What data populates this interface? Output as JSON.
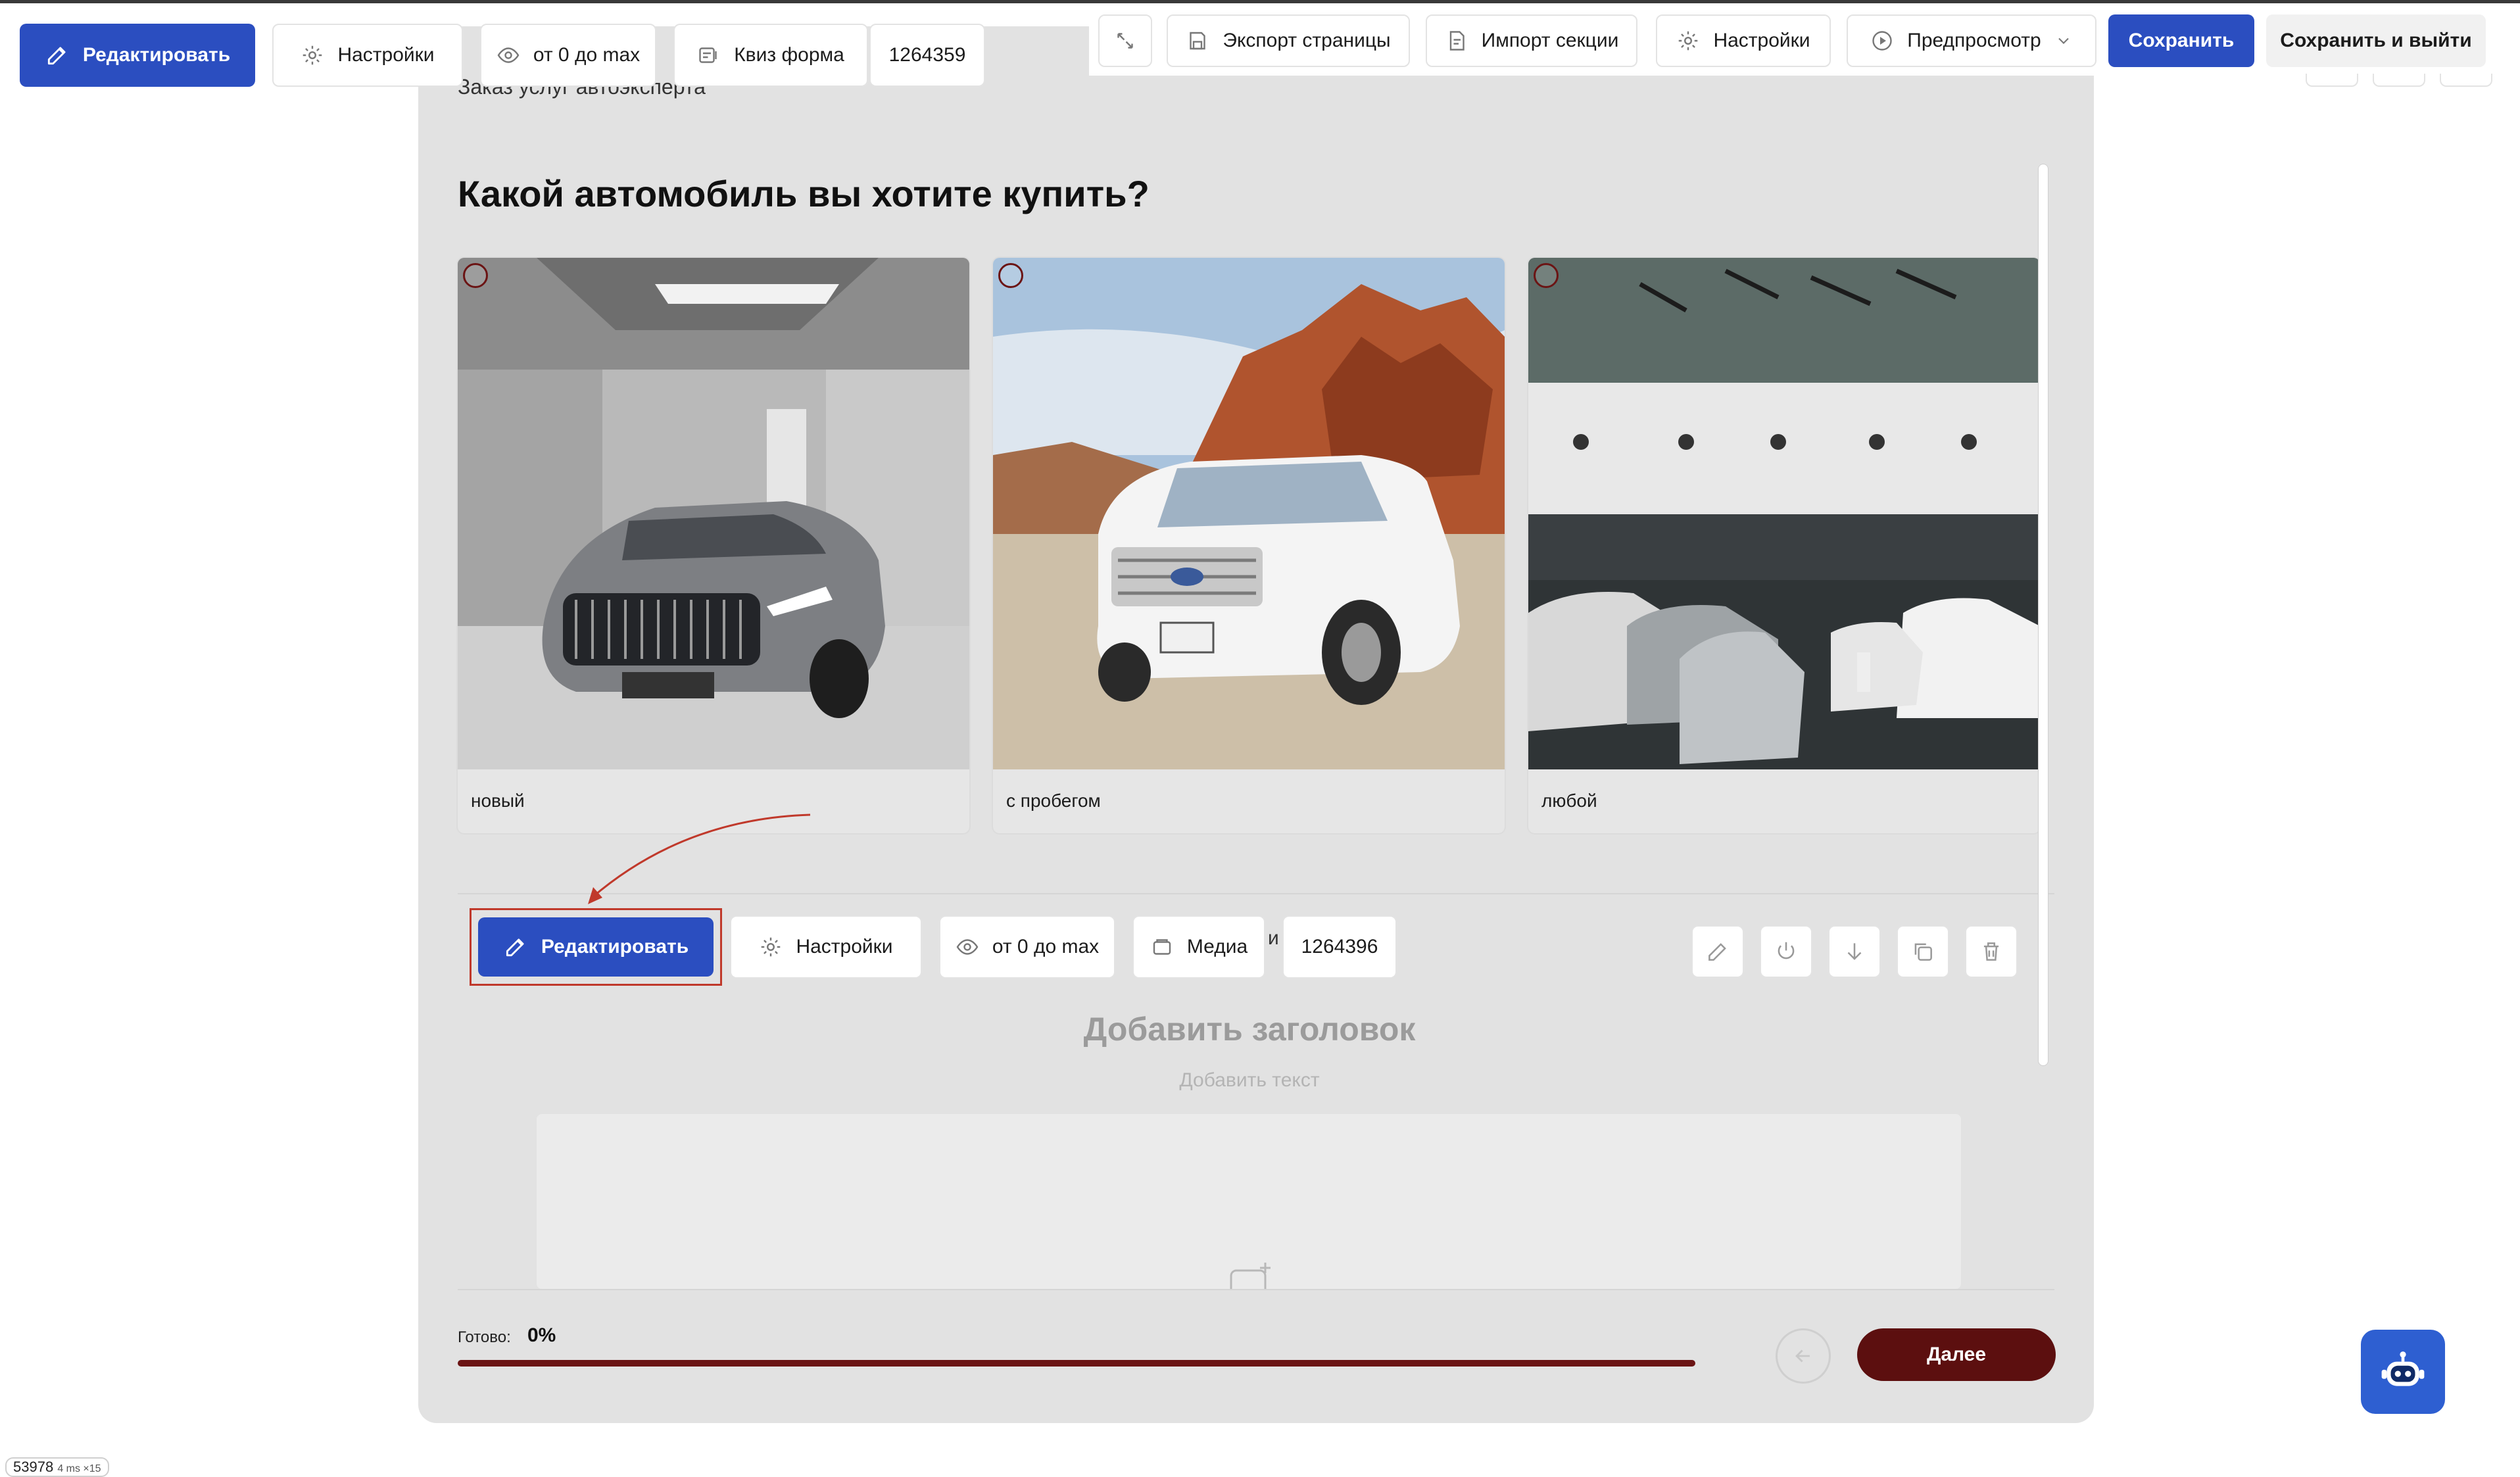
{
  "colors": {
    "primary": "#2b4ec0",
    "accent": "#6b1414",
    "next_button": "#5c0f0f",
    "highlight": "#c0392b",
    "canvas": "#e2e2e2",
    "assistant": "#2e5fd1"
  },
  "top_toolbar": {
    "expand_icon": "expand-arrows-icon",
    "export": "Экспорт страницы",
    "import": "Импорт секции",
    "settings": "Настройки",
    "preview": "Предпросмотр",
    "save": "Сохранить",
    "save_exit": "Сохранить и выйти"
  },
  "block_toolbar": {
    "edit": "Редактировать",
    "settings": "Настройки",
    "visibility": "от 0 до max",
    "type": "Квиз форма",
    "id": "1264359"
  },
  "quiz": {
    "form_title": "Заказ услуг автоэксперта",
    "question": "Какой автомобиль вы хотите купить?",
    "options": [
      {
        "label": "новый",
        "image": "silver-sedan-in-showroom"
      },
      {
        "label": "с пробегом",
        "image": "white-suv-in-desert"
      },
      {
        "label": "любой",
        "image": "dealership-hall-with-cars"
      }
    ]
  },
  "section_toolbar": {
    "edit": "Редактировать",
    "settings": "Настройки",
    "visibility": "от 0 до max",
    "media": "Медиа",
    "hidden_fragment": "и",
    "id": "1264396",
    "actions": [
      "pencil-icon",
      "power-icon",
      "arrow-down-icon",
      "copy-icon",
      "trash-icon"
    ]
  },
  "section": {
    "add_heading": "Добавить заголовок",
    "add_text": "Добавить текст"
  },
  "progress": {
    "label": "Готово:",
    "value_text": "0%",
    "fill_fraction": 1.0,
    "next": "Далее"
  },
  "counter": {
    "value": "53978",
    "sub": "4 ms ×15"
  }
}
